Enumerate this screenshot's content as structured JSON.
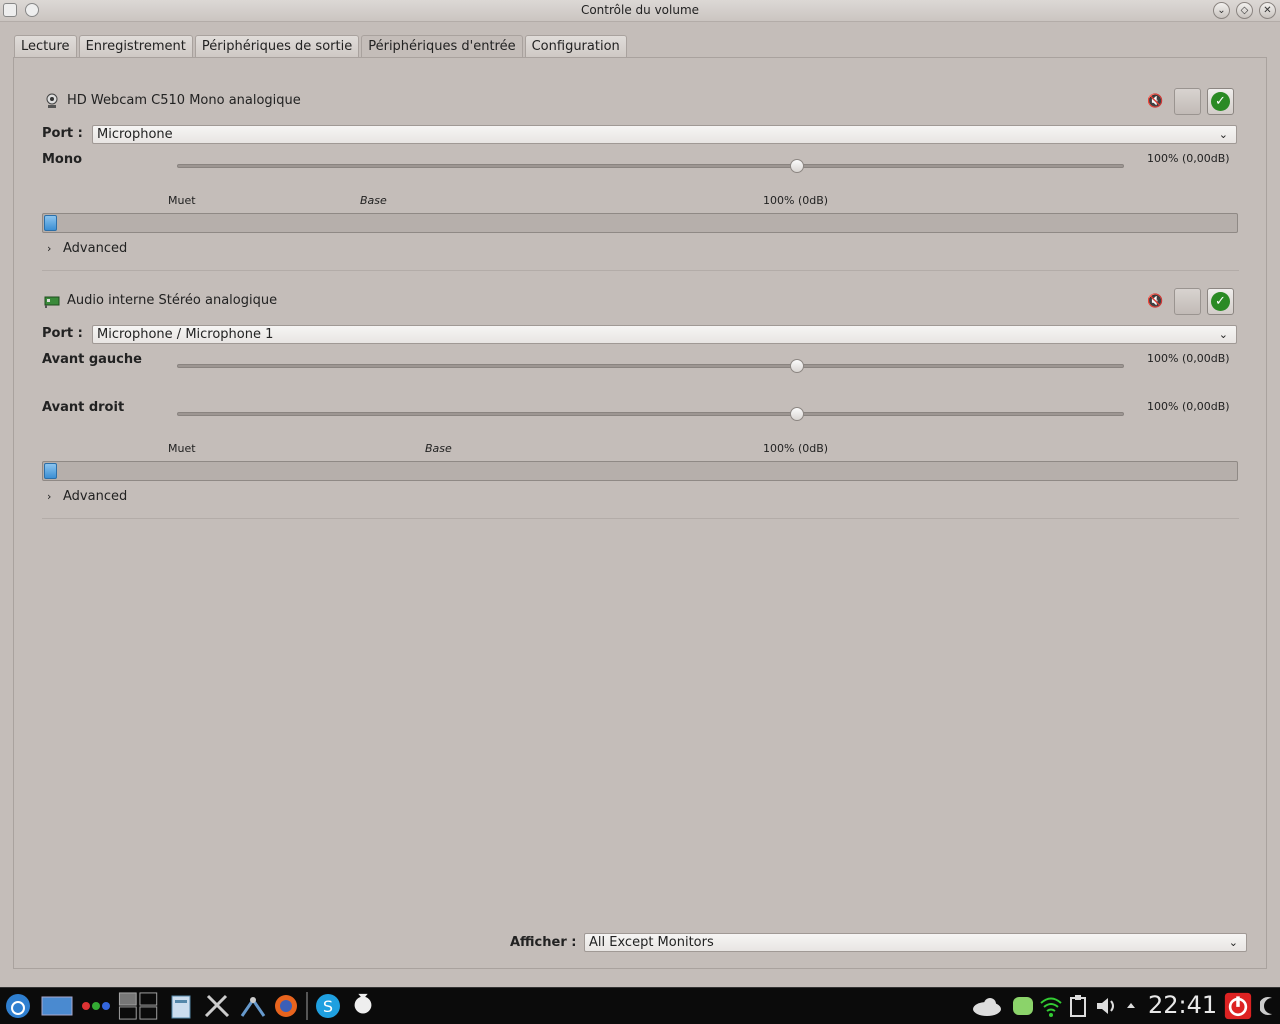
{
  "window": {
    "title": "Contrôle du volume"
  },
  "tabs": [
    {
      "label": "Lecture"
    },
    {
      "label": "Enregistrement"
    },
    {
      "label": "Périphériques de sortie"
    },
    {
      "label": "Périphériques d'entrée",
      "active": true
    },
    {
      "label": "Configuration"
    }
  ],
  "devices": [
    {
      "name": "HD Webcam C510 Mono analogique",
      "icon": "webcam-icon",
      "port_label": "Port :",
      "port_value": "Microphone",
      "channels": [
        {
          "name": "Mono",
          "value": "100% (0,00dB)",
          "level": 0.655
        }
      ],
      "marks": {
        "mute": "Muet",
        "base": "Base",
        "full": "100% (0dB)"
      },
      "meter_level": 0.01,
      "advanced": "Advanced"
    },
    {
      "name": "Audio interne Stéréo analogique",
      "icon": "sound-card-icon",
      "port_label": "Port :",
      "port_value": "Microphone / Microphone 1",
      "channels": [
        {
          "name": "Avant gauche",
          "value": "100% (0,00dB)",
          "level": 0.655
        },
        {
          "name": "Avant droit",
          "value": "100% (0,00dB)",
          "level": 0.655
        }
      ],
      "marks": {
        "mute": "Muet",
        "base": "Base",
        "full": "100% (0dB)"
      },
      "meter_level": 0.01,
      "advanced": "Advanced"
    }
  ],
  "show": {
    "label": "Afficher :",
    "value": "All Except Monitors"
  },
  "taskbar": {
    "clock": "22:41",
    "icons": [
      "kde-menu-icon",
      "desktop-icon",
      "dots-icon",
      "pager-icon",
      "file-manager-icon",
      "tools-icon",
      "network-tool-icon",
      "firefox-icon",
      "skype-icon",
      "mascot-icon",
      "cloud-icon",
      "chat-icon",
      "wifi-icon",
      "clipboard-icon",
      "volume-icon",
      "tray-arrow-icon",
      "power-icon",
      "moon-icon"
    ]
  }
}
